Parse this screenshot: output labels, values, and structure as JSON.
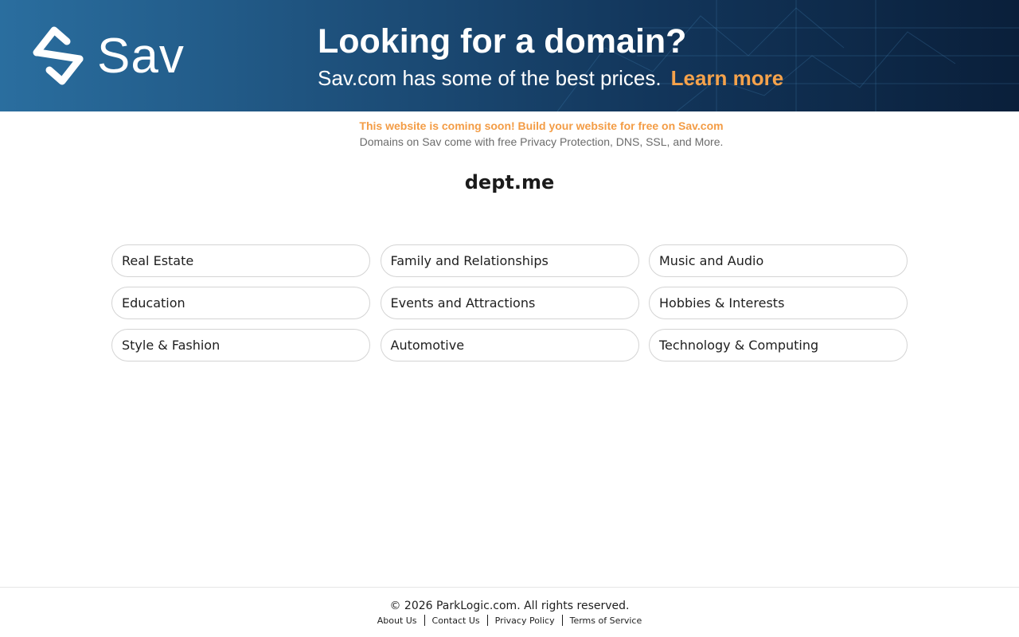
{
  "banner": {
    "logo_text": "Sav",
    "headline": "Looking for a domain?",
    "subline": "Sav.com has some of the best prices.",
    "learn_more": "Learn more",
    "accent_color": "#f5a24b"
  },
  "notice": {
    "promo": "This website is coming soon! Build your website for free on Sav.com",
    "features": "Domains on Sav come with free Privacy Protection, DNS, SSL, and More."
  },
  "domain": "dept.me",
  "categories": [
    "Real Estate",
    "Family and Relationships",
    "Music and Audio",
    "Education",
    "Events and Attractions",
    "Hobbies & Interests",
    "Style & Fashion",
    "Automotive",
    "Technology & Computing"
  ],
  "footer": {
    "copyright": "© 2026 ParkLogic.com. All rights reserved.",
    "links": [
      "About Us",
      "Contact Us",
      "Privacy Policy",
      "Terms of Service"
    ]
  }
}
